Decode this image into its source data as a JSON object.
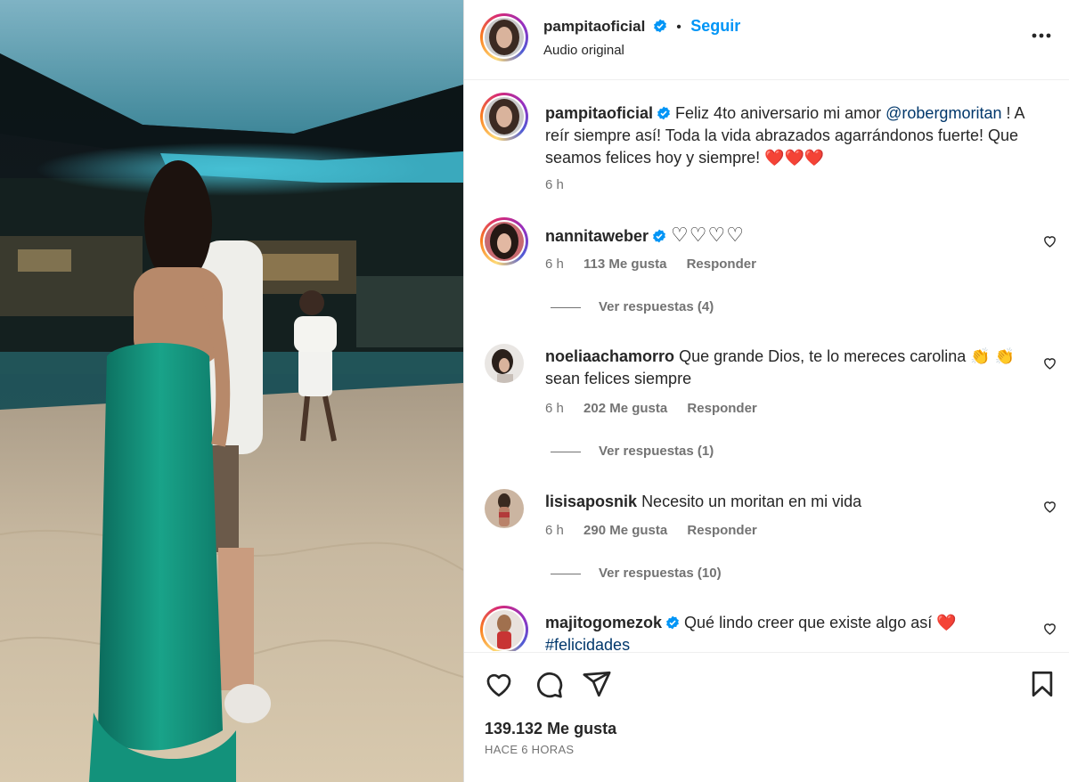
{
  "post": {
    "author": "pampitaoficial",
    "follow_label": "Seguir",
    "separator": "•",
    "audio_label": "Audio original",
    "caption": {
      "username": "pampitaoficial",
      "text_before": "Feliz 4to aniversario mi amor",
      "mention": "@robergmoritan",
      "text_after": "! A reír siempre así! Toda la vida abrazados agarrándonos fuerte! Que seamos felices hoy y siempre!",
      "emoji": "❤️❤️❤️",
      "time": "6 h"
    },
    "likes_label": "139.132 Me gusta",
    "time_ago": "HACE 6 HORAS"
  },
  "comments": [
    {
      "username": "nannitaweber",
      "verified": true,
      "text": "♡♡♡♡",
      "time": "6 h",
      "likes": "113 Me gusta",
      "reply_label": "Responder",
      "view_replies": "Ver respuestas (4)"
    },
    {
      "username": "noeliaachamorro",
      "verified": false,
      "text": "Que grande Dios, te lo mereces carolina 👏 👏 sean felices siempre",
      "time": "6 h",
      "likes": "202 Me gusta",
      "reply_label": "Responder",
      "view_replies": "Ver respuestas (1)"
    },
    {
      "username": "lisisaposnik",
      "verified": false,
      "text": "Necesito un moritan en mi vida",
      "time": "6 h",
      "likes": "290 Me gusta",
      "reply_label": "Responder",
      "view_replies": "Ver respuestas (10)"
    },
    {
      "username": "majitogomezok",
      "verified": true,
      "text": "Qué lindo creer que existe algo así ❤️",
      "hashtag": "#felicidades"
    }
  ],
  "icons": {
    "like": "heart-icon",
    "comment": "comment-bubble-icon",
    "share": "paper-plane-icon",
    "save": "bookmark-icon",
    "more": "more-options-icon",
    "verified": "verified-badge-icon"
  },
  "colors": {
    "accent": "#0095f6",
    "verified": "#0095f6",
    "link": "#00376b",
    "muted": "#737373",
    "heart_emoji": "#e0245e"
  }
}
